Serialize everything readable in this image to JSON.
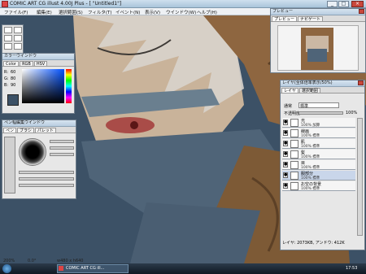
{
  "window": {
    "title": "COMIC ART CG illust 4.00J Plus - [ \"Untitled1\"]"
  },
  "menu": [
    "ファイル(F)",
    "編集(E)",
    "選択範囲(S)",
    "フィルタ(T)",
    "イベント(N)",
    "表示(V)",
    "ウインドウ(W)",
    "ヘルプ(H)"
  ],
  "color_panel": {
    "title": "カラーウインドウ",
    "tabs": [
      "Color",
      "RGB",
      "HSV"
    ],
    "values": [
      {
        "label": "R:",
        "value": "60"
      },
      {
        "label": "G:",
        "value": "80"
      },
      {
        "label": "B:",
        "value": "90"
      }
    ]
  },
  "pen_panel": {
    "title": "ペン幅編集ウインドウ",
    "tabs": [
      "ペン",
      "ブラシ",
      "パレット"
    ]
  },
  "preview_panel": {
    "title": "プレビュー",
    "tabs": [
      "プレビュー",
      "ナビゲート"
    ]
  },
  "layer_panel": {
    "title": "レイヤ(全体倍率表示/50%)",
    "tabs": [
      "レイヤ",
      "選択範囲"
    ],
    "mode_label": "通常",
    "mode_value": "標準",
    "opacity_label": "不透明度",
    "opacity_value": "100%",
    "layers": [
      {
        "name": "光",
        "mode": "100% 加算"
      },
      {
        "name": "線画",
        "mode": "100% 標準"
      },
      {
        "name": "肌",
        "mode": "100% 標準"
      },
      {
        "name": "髪",
        "mode": "100% 標準"
      },
      {
        "name": "目",
        "mode": "100% 標準"
      },
      {
        "name": "服部分",
        "mode": "100% 標準"
      },
      {
        "name": "お空の背景",
        "mode": "100% 標準"
      }
    ],
    "status": "レイヤ: 2073KB, アンドウ: 412K"
  },
  "statusbar": {
    "zoom": "200%",
    "angle": "0.0°",
    "size": "w480 x h640"
  },
  "taskbar": {
    "task": "COMIC ART CG ill...",
    "clock": "17:53"
  }
}
